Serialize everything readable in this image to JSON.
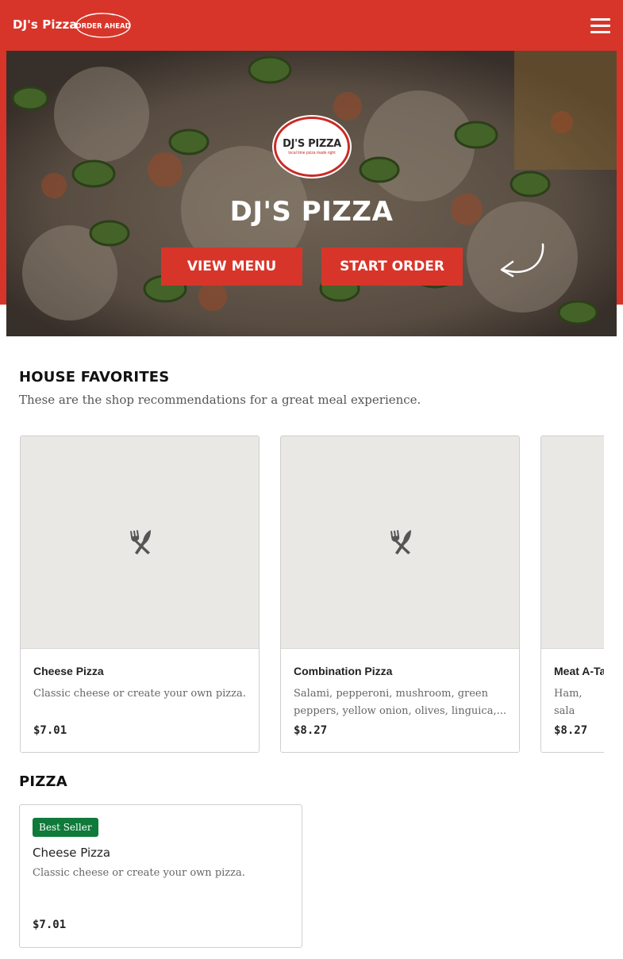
{
  "header": {
    "brand": "DJ's Pizza",
    "order_ahead_badge": "ORDER AHEAD",
    "menu_icon": "hamburger-menu-icon",
    "colors": {
      "brand_red": "#d8352a"
    }
  },
  "hero": {
    "logo_text": "DJ'S PIZZA",
    "logo_tagline": "local time pizza made right",
    "title": "DJ'S PIZZA",
    "view_menu_label": "VIEW MENU",
    "start_order_label": "START ORDER"
  },
  "house_favorites": {
    "title": "HOUSE FAVORITES",
    "subtitle": "These are the shop recommendations for a great meal experience.",
    "placeholder_icon": "utensils-icon",
    "items": [
      {
        "name": "Cheese Pizza",
        "description": "Classic cheese or create your own pizza.",
        "price": "$7.01"
      },
      {
        "name": "Combination Pizza",
        "description": "Salami, pepperoni, mushroom, green peppers, yellow onion, olives, linguica,...",
        "price": "$8.27"
      },
      {
        "name": "Meat A-Ta",
        "description": "Ham, sala beef, and",
        "price": "$8.27"
      }
    ]
  },
  "pizza_section": {
    "title": "PIZZA",
    "items": [
      {
        "badge": "Best Seller",
        "name": "Cheese Pizza",
        "description": "Classic cheese or create your own pizza.",
        "price": "$7.01",
        "badge_color": "#0f7a3a"
      }
    ]
  }
}
